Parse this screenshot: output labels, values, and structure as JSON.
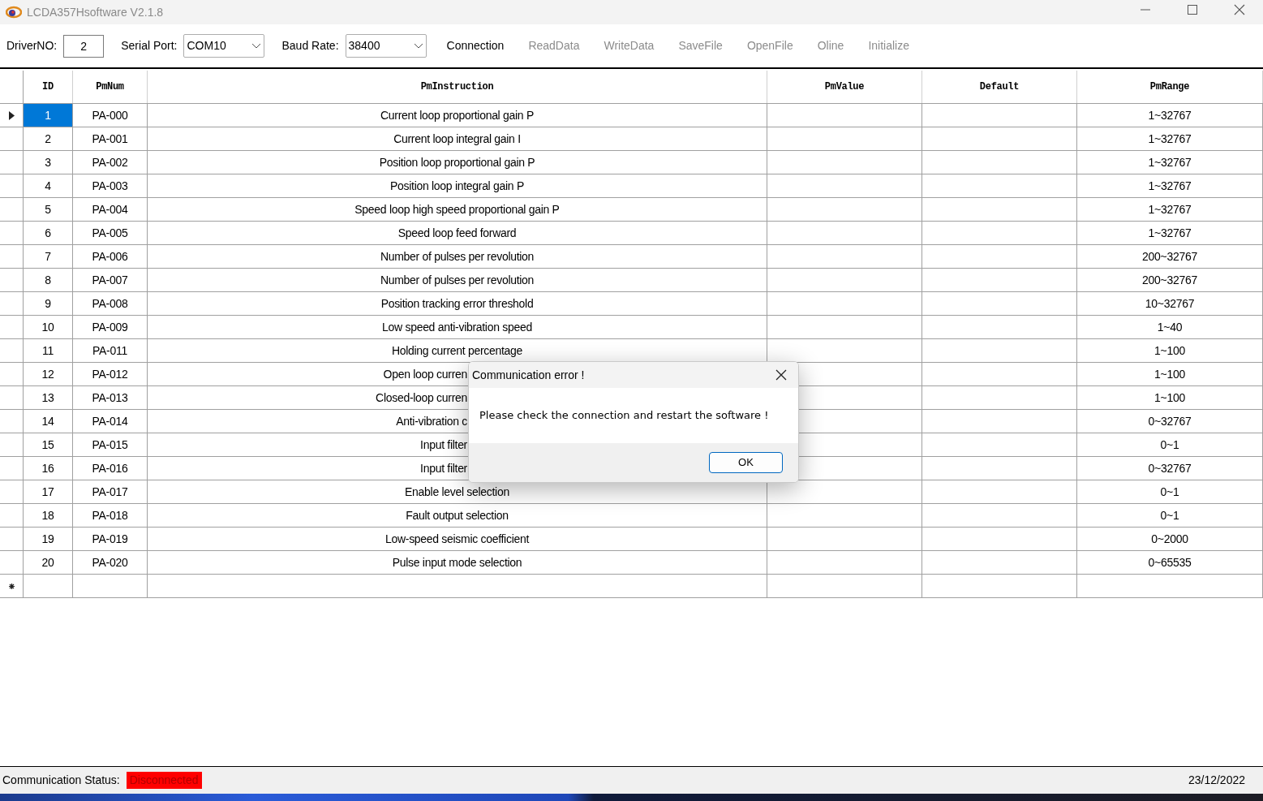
{
  "window": {
    "title": "LCDA357Hsoftware V2.1.8"
  },
  "toolbar": {
    "driver_label": "DriverNO:",
    "driver_value": "2",
    "port_label": "Serial Port:",
    "port_value": "COM10",
    "baud_label": "Baud Rate:",
    "baud_value": "38400",
    "actions": [
      {
        "label": "Connection",
        "disabled": false
      },
      {
        "label": "ReadData",
        "disabled": true
      },
      {
        "label": "WriteData",
        "disabled": true
      },
      {
        "label": "SaveFile",
        "disabled": true
      },
      {
        "label": "OpenFile",
        "disabled": true
      },
      {
        "label": "Oline",
        "disabled": true
      },
      {
        "label": "Initialize",
        "disabled": true
      }
    ]
  },
  "table": {
    "columns": [
      "ID",
      "PmNum",
      "PmInstruction",
      "PmValue",
      "Default",
      "PmRange"
    ],
    "rows": [
      {
        "cells": [
          "1",
          "PA-000",
          "Current loop proportional gain P",
          "",
          "",
          "1~32767"
        ],
        "selected": true,
        "clipped": false
      },
      {
        "cells": [
          "2",
          "PA-001",
          "Current loop integral gain I",
          "",
          "",
          "1~32767"
        ],
        "selected": false,
        "clipped": false
      },
      {
        "cells": [
          "3",
          "PA-002",
          "Position loop proportional gain P",
          "",
          "",
          "1~32767"
        ],
        "selected": false,
        "clipped": false
      },
      {
        "cells": [
          "4",
          "PA-003",
          "Position loop integral gain P",
          "",
          "",
          "1~32767"
        ],
        "selected": false,
        "clipped": false
      },
      {
        "cells": [
          "5",
          "PA-004",
          "Speed loop high speed proportional gain P",
          "",
          "",
          "1~32767"
        ],
        "selected": false,
        "clipped": false
      },
      {
        "cells": [
          "6",
          "PA-005",
          "Speed loop feed forward",
          "",
          "",
          "1~32767"
        ],
        "selected": false,
        "clipped": false
      },
      {
        "cells": [
          "7",
          "PA-006",
          "Number of pulses per revolution",
          "",
          "",
          "200~32767"
        ],
        "selected": false,
        "clipped": false
      },
      {
        "cells": [
          "8",
          "PA-007",
          "Number of pulses per revolution",
          "",
          "",
          "200~32767"
        ],
        "selected": false,
        "clipped": false
      },
      {
        "cells": [
          "9",
          "PA-008",
          "Position tracking error threshold",
          "",
          "",
          "10~32767"
        ],
        "selected": false,
        "clipped": false
      },
      {
        "cells": [
          "10",
          "PA-009",
          "Low speed anti-vibration speed",
          "",
          "",
          "1~40"
        ],
        "selected": false,
        "clipped": false
      },
      {
        "cells": [
          "11",
          "PA-011",
          "Holding current percentage",
          "",
          "",
          "1~100"
        ],
        "selected": false,
        "clipped": false
      },
      {
        "cells": [
          "12",
          "PA-012",
          "Open loop curren",
          "",
          "",
          "1~100"
        ],
        "selected": false,
        "clipped": true
      },
      {
        "cells": [
          "13",
          "PA-013",
          "Closed-loop curren",
          "",
          "",
          "1~100"
        ],
        "selected": false,
        "clipped": true
      },
      {
        "cells": [
          "14",
          "PA-014",
          "Anti-vibration c",
          "",
          "",
          "0~32767"
        ],
        "selected": false,
        "clipped": true
      },
      {
        "cells": [
          "15",
          "PA-015",
          "Input filter",
          "",
          "",
          "0~1"
        ],
        "selected": false,
        "clipped": true
      },
      {
        "cells": [
          "16",
          "PA-016",
          "Input filter",
          "",
          "",
          "0~32767"
        ],
        "selected": false,
        "clipped": true
      },
      {
        "cells": [
          "17",
          "PA-017",
          "Enable level selection",
          "",
          "",
          "0~1"
        ],
        "selected": false,
        "clipped": false
      },
      {
        "cells": [
          "18",
          "PA-018",
          "Fault output selection",
          "",
          "",
          "0~1"
        ],
        "selected": false,
        "clipped": false
      },
      {
        "cells": [
          "19",
          "PA-019",
          "Low-speed seismic coefficient",
          "",
          "",
          "0~2000"
        ],
        "selected": false,
        "clipped": false
      },
      {
        "cells": [
          "20",
          "PA-020",
          "Pulse input mode selection",
          "",
          "",
          "0~65535"
        ],
        "selected": false,
        "clipped": false
      }
    ]
  },
  "dialog": {
    "title": "Communication error !",
    "message": "Please check the connection and restart the software !",
    "button": "OK"
  },
  "status_bar": {
    "label": "Communication Status:",
    "status": "Disconnected",
    "connected": false,
    "date": "23/12/2022"
  }
}
